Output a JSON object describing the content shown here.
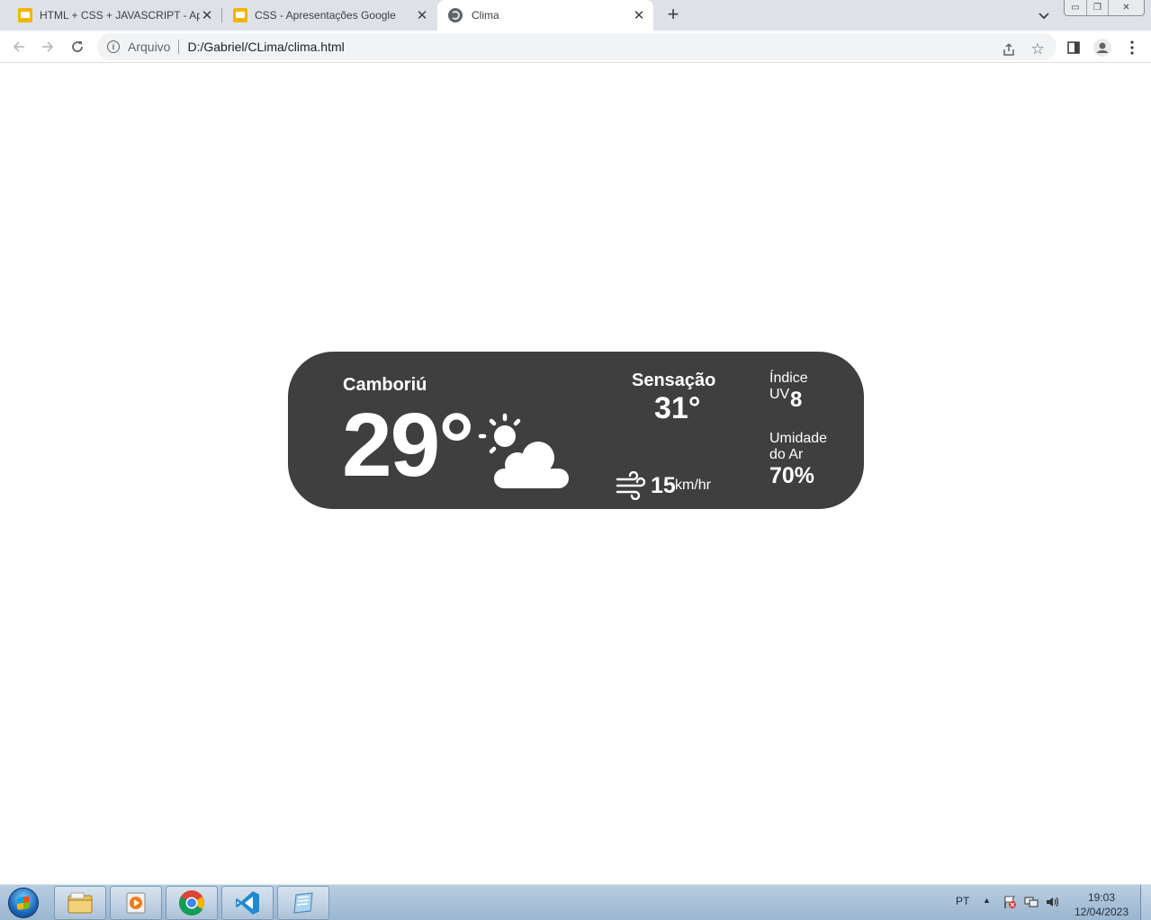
{
  "browser": {
    "tabs": [
      {
        "title": "HTML + CSS + JAVASCRIPT - Apr",
        "favicon": "google-slides-icon",
        "active": false
      },
      {
        "title": "CSS - Apresentações Google",
        "favicon": "google-slides-icon",
        "active": false
      },
      {
        "title": "Clima",
        "favicon": "globe-icon",
        "active": true
      }
    ],
    "address": {
      "security_chip": "Arquivo",
      "url": "D:/Gabriel/CLima/clima.html"
    }
  },
  "weather": {
    "city": "Camboriú",
    "temperature": "29°",
    "condition_icon": "partly-cloudy-icon",
    "feels_like_label": "Sensação",
    "feels_like_value": "31°",
    "wind_value": "15",
    "wind_unit": "km/hr",
    "uv_label_line1": "Índice",
    "uv_label_line2": "UV",
    "uv_value": "8",
    "humidity_label_line1": "Umidade",
    "humidity_label_line2": "do Ar",
    "humidity_value": "70%"
  },
  "taskbar": {
    "language": "PT",
    "time": "19:03",
    "date": "12/04/2023",
    "apps": [
      "explorer-icon",
      "media-player-icon",
      "chrome-icon",
      "vscode-icon",
      "notepad-icon"
    ]
  },
  "colors": {
    "card_background": "#3f3f3f",
    "card_text": "#ffffff",
    "tabstrip": "#dee1e6",
    "slides_yellow": "#f4b400"
  }
}
